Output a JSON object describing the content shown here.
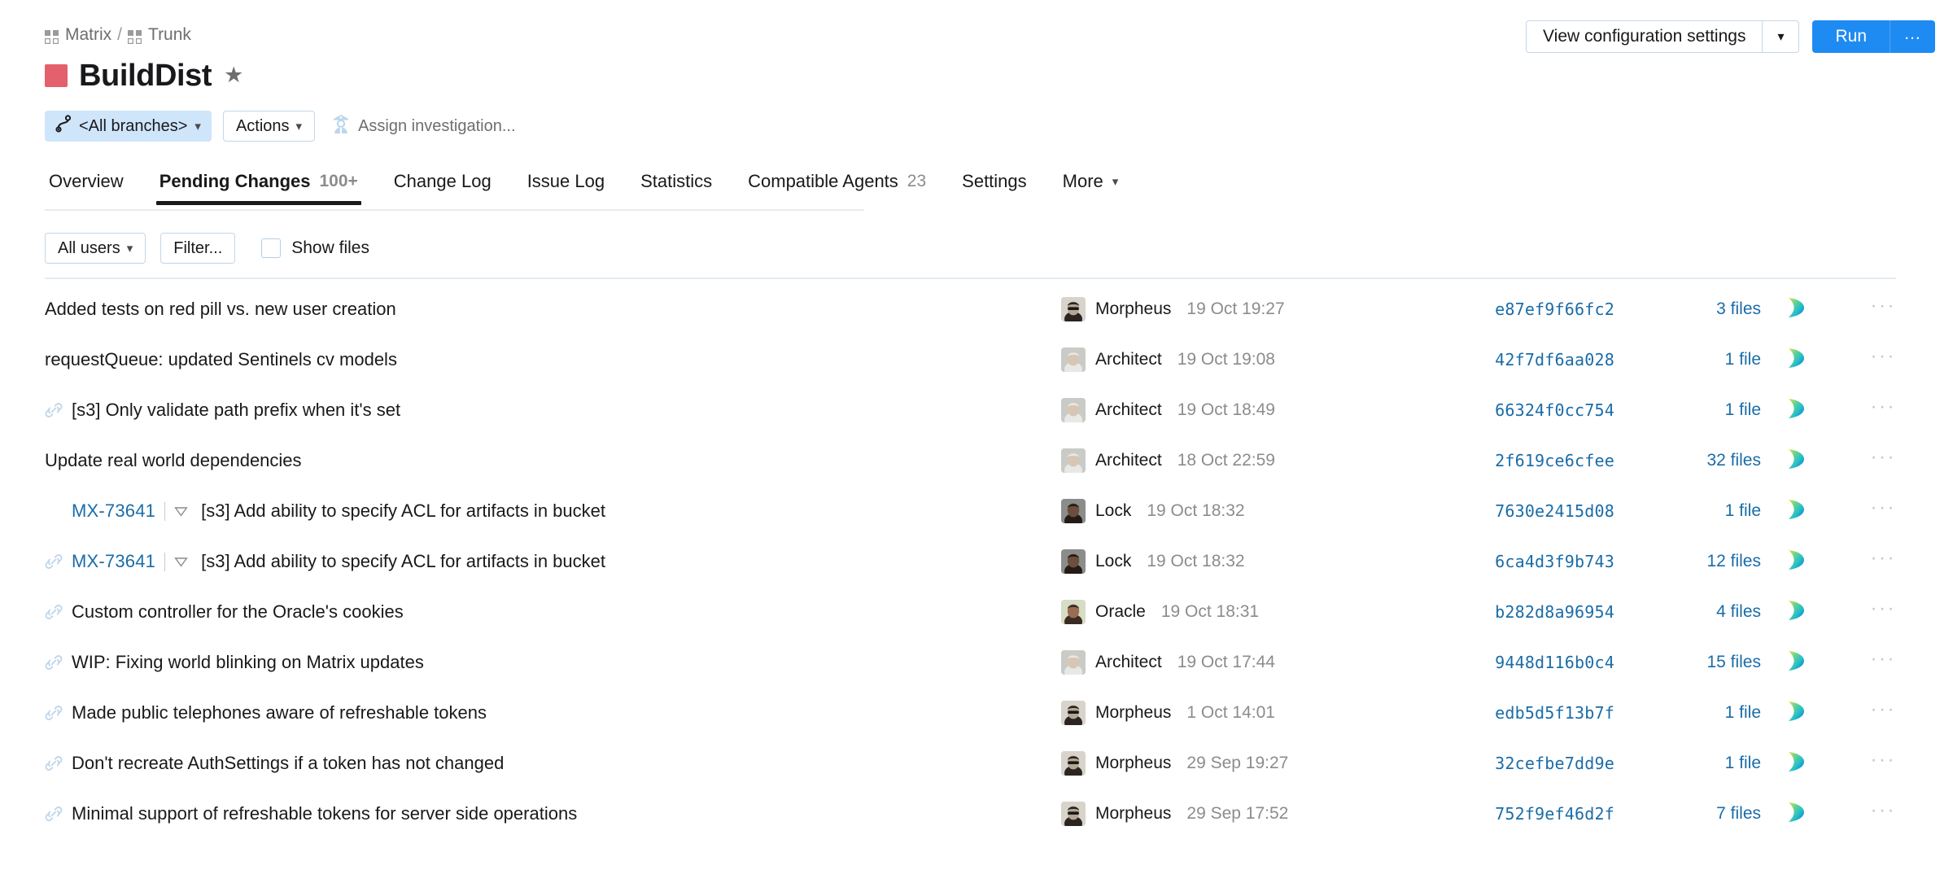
{
  "breadcrumb": {
    "project": "Matrix",
    "separator": "/",
    "subproject": "Trunk"
  },
  "header": {
    "build_title": "BuildDist",
    "build_color": "#e4606d",
    "star_glyph": "★",
    "branch_selector": "<All branches>",
    "actions_button": "Actions",
    "assign_investigation": "Assign investigation..."
  },
  "top_right": {
    "vcs_settings": "View configuration settings",
    "run_label": "Run",
    "run_more_label": "...",
    "accent_color": "#1e8bf2"
  },
  "tabs": [
    {
      "label": "Overview",
      "count": "",
      "active": false
    },
    {
      "label": "Pending Changes",
      "count": "100+",
      "active": true
    },
    {
      "label": "Change Log",
      "count": "",
      "active": false
    },
    {
      "label": "Issue Log",
      "count": "",
      "active": false
    },
    {
      "label": "Statistics",
      "count": "",
      "active": false
    },
    {
      "label": "Compatible Agents",
      "count": "23",
      "active": false
    },
    {
      "label": "Settings",
      "count": "",
      "active": false
    },
    {
      "label": "More",
      "count": "",
      "active": false,
      "has_caret": true
    }
  ],
  "filterbar": {
    "users_filter": "All users",
    "filter_button": "Filter...",
    "show_files_label": "Show files",
    "show_files_checked": false
  },
  "changes": [
    {
      "link_icon": false,
      "issue_id": "",
      "message": "Added tests on red pill vs. new user creation",
      "author": "Morpheus",
      "avatar": "morpheus",
      "date": "19 Oct 19:27",
      "hash": "e87ef9f66fc2",
      "files": "3 files"
    },
    {
      "link_icon": false,
      "issue_id": "",
      "message": "requestQueue: updated Sentinels cv models",
      "author": "Architect",
      "avatar": "architect",
      "date": "19 Oct 19:08",
      "hash": "42f7df6aa028",
      "files": "1 file"
    },
    {
      "link_icon": true,
      "issue_id": "",
      "message": "[s3] Only validate path prefix when it's set",
      "author": "Architect",
      "avatar": "architect",
      "date": "19 Oct 18:49",
      "hash": "66324f0cc754",
      "files": "1 file"
    },
    {
      "link_icon": false,
      "issue_id": "",
      "message": "Update real world dependencies",
      "author": "Architect",
      "avatar": "architect",
      "date": "18 Oct 22:59",
      "hash": "2f619ce6cfee",
      "files": "32 files"
    },
    {
      "link_icon": false,
      "issue_id": "MX-73641",
      "message": "[s3] Add ability to specify ACL for artifacts in bucket",
      "author": "Lock",
      "avatar": "lock",
      "date": "19 Oct 18:32",
      "hash": "7630e2415d08",
      "files": "1 file"
    },
    {
      "link_icon": true,
      "issue_id": "MX-73641",
      "message": "[s3] Add ability to specify ACL for artifacts in bucket",
      "author": "Lock",
      "avatar": "lock",
      "date": "19 Oct 18:32",
      "hash": "6ca4d3f9b743",
      "files": "12 files"
    },
    {
      "link_icon": true,
      "issue_id": "",
      "message": "Custom controller for the Oracle's cookies",
      "author": "Oracle",
      "avatar": "oracle",
      "date": "19 Oct 18:31",
      "hash": "b282d8a96954",
      "files": "4 files"
    },
    {
      "link_icon": true,
      "issue_id": "",
      "message": "WIP: Fixing world blinking on Matrix updates",
      "author": "Architect",
      "avatar": "architect",
      "date": "19 Oct 17:44",
      "hash": "9448d116b0c4",
      "files": "15 files"
    },
    {
      "link_icon": true,
      "issue_id": "",
      "message": "Made public telephones aware of refreshable tokens",
      "author": "Morpheus",
      "avatar": "morpheus",
      "date": "1 Oct 14:01",
      "hash": "edb5d5f13b7f",
      "files": "1 file"
    },
    {
      "link_icon": true,
      "issue_id": "",
      "message": "Don't recreate AuthSettings if a token has not changed",
      "author": "Morpheus",
      "avatar": "morpheus",
      "date": "29 Sep 19:27",
      "hash": "32cefbe7dd9e",
      "files": "1 file"
    },
    {
      "link_icon": true,
      "issue_id": "",
      "message": "Minimal support of refreshable tokens for server side operations",
      "author": "Morpheus",
      "avatar": "morpheus",
      "date": "29 Sep 17:52",
      "hash": "752f9ef46d2f",
      "files": "7 files"
    }
  ],
  "icons": {
    "row_menu": "···"
  }
}
